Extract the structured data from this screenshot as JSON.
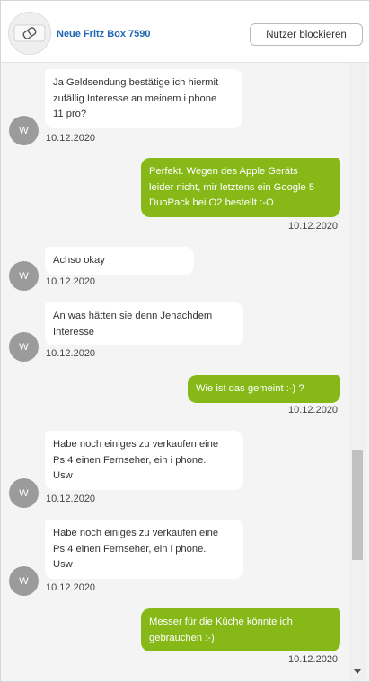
{
  "header": {
    "title": "Neue Fritz Box 7590",
    "block_button": "Nutzer blockieren"
  },
  "user_initial": "W",
  "messages": [
    {
      "dir": "in",
      "lines": [
        "Ja Geldsendung bestätige ich hiermit",
        "zufällig Interesse an meinem i phone",
        "11 pro?"
      ],
      "time": "10.12.2020"
    },
    {
      "dir": "out",
      "lines": [
        "Perfekt. Wegen des Apple Geräts",
        "leider nicht, mir letztens ein Google 5",
        "DuoPack bei O2 bestellt :-O"
      ],
      "time": "10.12.2020"
    },
    {
      "dir": "in",
      "lines": [
        "Achso okay"
      ],
      "time": "10.12.2020"
    },
    {
      "dir": "in",
      "lines": [
        "An was hätten sie denn Jenachdem",
        "Interesse"
      ],
      "time": "10.12.2020"
    },
    {
      "dir": "out",
      "lines": [
        "Wie ist das gemeint :-) ?"
      ],
      "time": "10.12.2020"
    },
    {
      "dir": "in",
      "lines": [
        "Habe noch einiges zu verkaufen eine",
        "Ps 4 einen Fernseher, ein i phone.",
        "Usw"
      ],
      "time": "10.12.2020"
    },
    {
      "dir": "in",
      "lines": [
        "Habe noch einiges zu verkaufen eine",
        "Ps 4 einen Fernseher, ein i phone.",
        "Usw"
      ],
      "time": "10.12.2020"
    },
    {
      "dir": "out",
      "lines": [
        "Messer für die Küche könnte ich",
        "gebrauchen :-)"
      ],
      "time": "10.12.2020"
    }
  ]
}
